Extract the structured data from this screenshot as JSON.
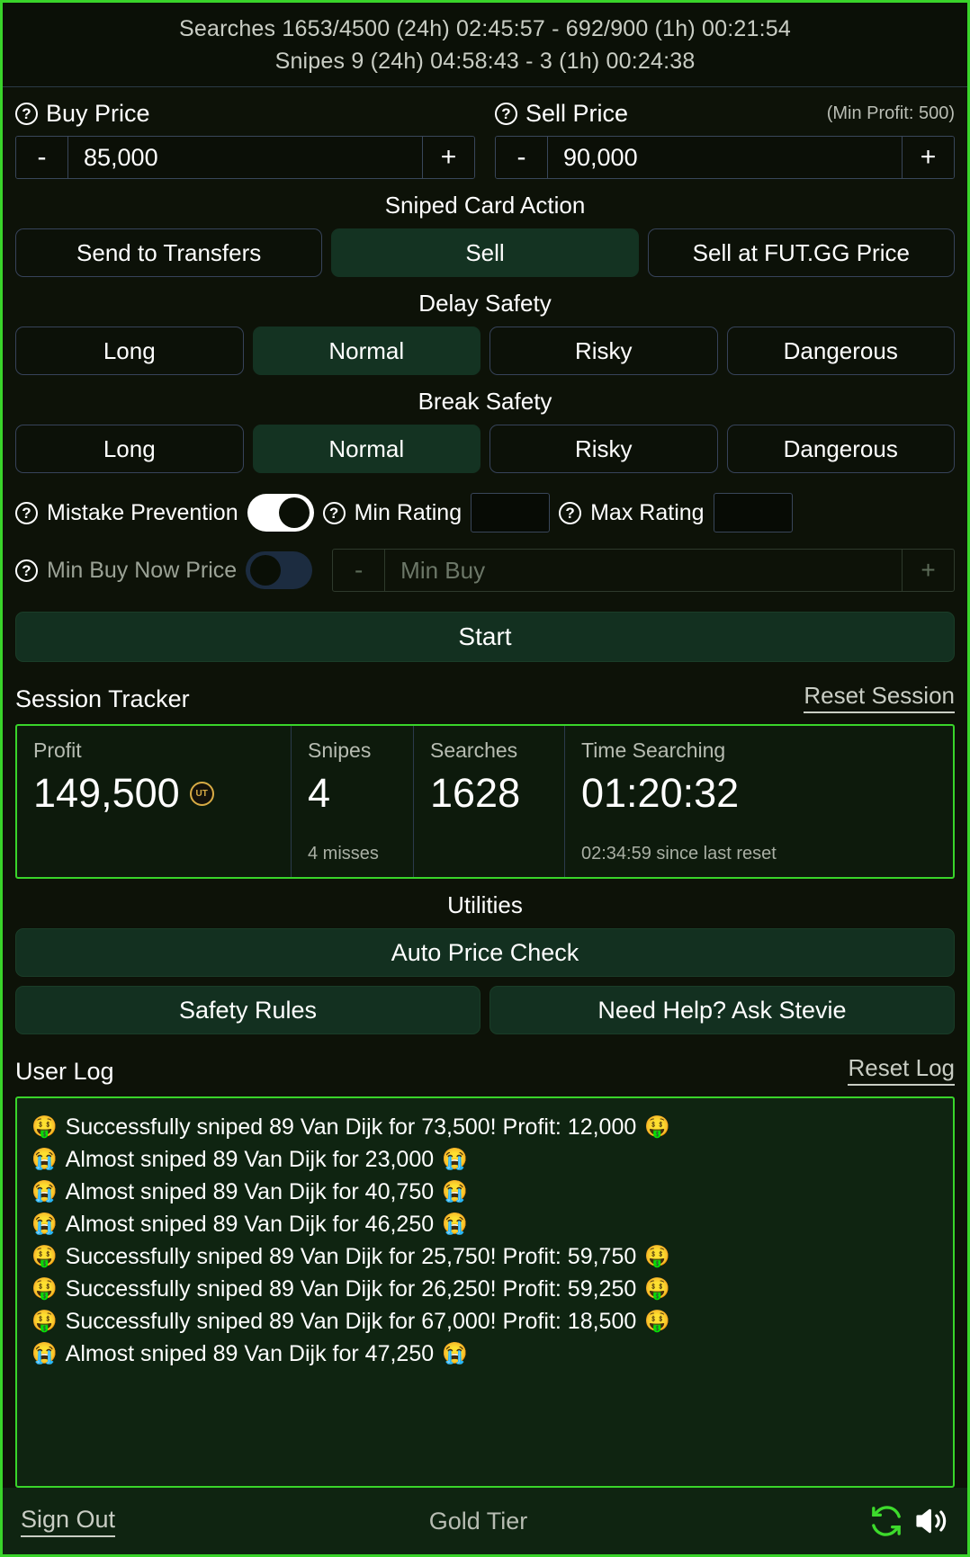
{
  "header": {
    "searches_line": "Searches  1653/4500 (24h) 02:45:57  -  692/900 (1h) 00:21:54",
    "snipes_line": "Snipes  9 (24h) 04:58:43  -  3 (1h) 00:24:38"
  },
  "prices": {
    "buy_label": "Buy Price",
    "buy_value": "85,000",
    "sell_label": "Sell Price",
    "sell_value": "90,000",
    "min_profit": "(Min Profit: 500)",
    "minus": "-",
    "plus": "+"
  },
  "sniped_card_action": {
    "title": "Sniped Card Action",
    "options": [
      {
        "label": "Send to Transfers",
        "selected": false
      },
      {
        "label": "Sell",
        "selected": true
      },
      {
        "label": "Sell at FUT.GG Price",
        "selected": false
      }
    ]
  },
  "delay_safety": {
    "title": "Delay Safety",
    "options": [
      {
        "label": "Long",
        "selected": false
      },
      {
        "label": "Normal",
        "selected": true
      },
      {
        "label": "Risky",
        "selected": false
      },
      {
        "label": "Dangerous",
        "selected": false
      }
    ]
  },
  "break_safety": {
    "title": "Break Safety",
    "options": [
      {
        "label": "Long",
        "selected": false
      },
      {
        "label": "Normal",
        "selected": true
      },
      {
        "label": "Risky",
        "selected": false
      },
      {
        "label": "Dangerous",
        "selected": false
      }
    ]
  },
  "settings": {
    "mistake_prevention_label": "Mistake Prevention",
    "mistake_prevention_on": true,
    "min_rating_label": "Min Rating",
    "min_rating_value": "",
    "max_rating_label": "Max Rating",
    "max_rating_value": "",
    "min_buy_now_label": "Min Buy Now Price",
    "min_buy_now_on": false,
    "min_buy_placeholder": "Min Buy",
    "minus": "-",
    "plus": "+"
  },
  "start_button": "Start",
  "session_tracker": {
    "title": "Session Tracker",
    "reset_label": "Reset Session",
    "profit_label": "Profit",
    "profit_value": "149,500",
    "coin_icon": "UT",
    "snipes_label": "Snipes",
    "snipes_value": "4",
    "snipes_sub": "4 misses",
    "searches_label": "Searches",
    "searches_value": "1628",
    "time_label": "Time Searching",
    "time_value": "01:20:32",
    "time_sub": "02:34:59 since last reset"
  },
  "utilities": {
    "title": "Utilities",
    "auto_price_check": "Auto Price Check",
    "safety_rules": "Safety Rules",
    "ask_stevie": "Need Help? Ask Stevie"
  },
  "user_log": {
    "title": "User Log",
    "reset_label": "Reset Log",
    "entries": [
      {
        "icon_left": "🤑",
        "text": "Successfully sniped 89 Van Dijk for 73,500! Profit: 12,000",
        "icon_right": "🤑"
      },
      {
        "icon_left": "😭",
        "text": "Almost sniped 89 Van Dijk for 23,000",
        "icon_right": "😭"
      },
      {
        "icon_left": "😭",
        "text": "Almost sniped 89 Van Dijk for 40,750",
        "icon_right": "😭"
      },
      {
        "icon_left": "😭",
        "text": "Almost sniped 89 Van Dijk for 46,250",
        "icon_right": "😭"
      },
      {
        "icon_left": "🤑",
        "text": "Successfully sniped 89 Van Dijk for 25,750! Profit: 59,750",
        "icon_right": "🤑"
      },
      {
        "icon_left": "🤑",
        "text": "Successfully sniped 89 Van Dijk for 26,250! Profit: 59,250",
        "icon_right": "🤑"
      },
      {
        "icon_left": "🤑",
        "text": "Successfully sniped 89 Van Dijk for 67,000! Profit: 18,500",
        "icon_right": "🤑"
      },
      {
        "icon_left": "😭",
        "text": "Almost sniped 89 Van Dijk for 47,250",
        "icon_right": "😭"
      }
    ]
  },
  "footer": {
    "sign_out": "Sign Out",
    "tier": "Gold Tier",
    "refresh_icon": "refresh-icon",
    "sound_icon": "sound-on-icon"
  },
  "colors": {
    "accent_green": "#39d42a",
    "selected_fill": "#143322",
    "panel_bg": "#0d1208",
    "log_bg": "#0f2411",
    "coin_gold": "#d8ab45"
  }
}
